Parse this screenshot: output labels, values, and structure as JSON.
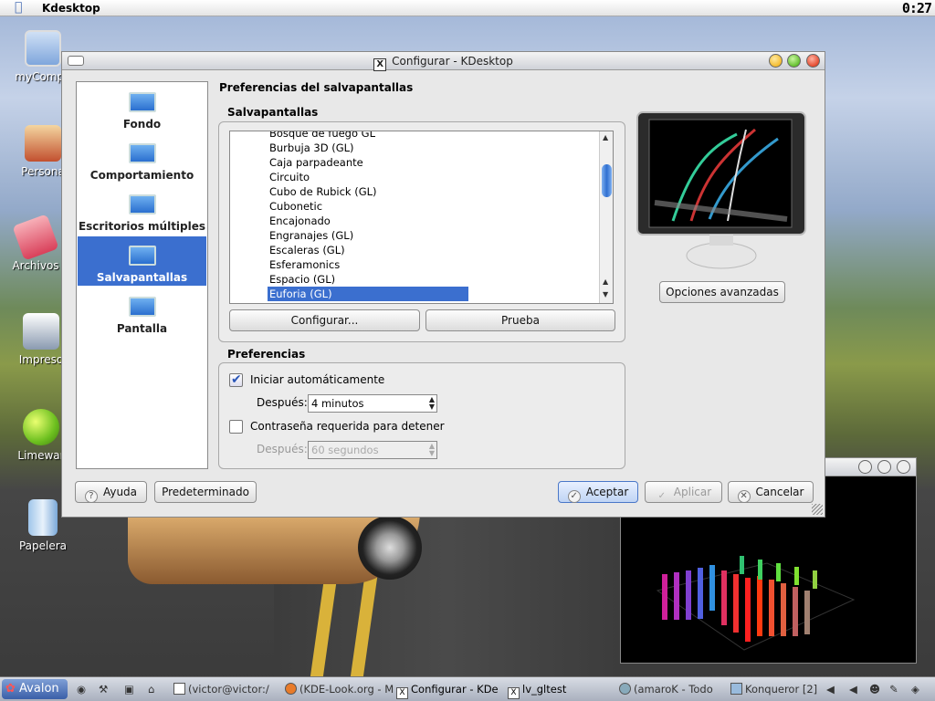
{
  "menubar": {
    "title": "Kdesktop",
    "clock": "0:27"
  },
  "desktop_icons": [
    {
      "label": "myCompu",
      "icon": "computer-icon"
    },
    {
      "label": "Persona",
      "icon": "home-icon"
    },
    {
      "label": "Archivos",
      "icon": "files-icon"
    },
    {
      "label": "Impreso",
      "icon": "printer-icon"
    },
    {
      "label": "Limewar",
      "icon": "limewire-icon"
    },
    {
      "label": "Papelera",
      "icon": "trash-icon"
    }
  ],
  "dialog": {
    "title": "Configurar - KDesktop",
    "sidebar": [
      {
        "label": "Fondo"
      },
      {
        "label": "Comportamiento"
      },
      {
        "label": "Escritorios múltiples"
      },
      {
        "label": "Salvapantallas",
        "selected": true
      },
      {
        "label": "Pantalla"
      }
    ],
    "heading": "Preferencias del salvapantallas",
    "saver_group": "Salvapantallas",
    "savers": [
      "Bosque de fuego GL",
      "Burbuja 3D (GL)",
      "Caja parpadeante",
      "Circuito",
      "Cubo de Rubick (GL)",
      "Cubonetic",
      "Encajonado",
      "Engranajes (GL)",
      "Escaleras (GL)",
      "Esferamonics",
      "Espacio (GL)",
      "Euforia (GL)"
    ],
    "selected_saver": "Euforia (GL)",
    "configure_btn": "Configurar...",
    "test_btn": "Prueba",
    "advanced_btn": "Opciones avanzadas",
    "prefs_group": "Preferencias",
    "auto_start": {
      "label": "Iniciar automáticamente",
      "checked": true
    },
    "after1_label": "Después:",
    "after1_value": "4 minutos",
    "password": {
      "label": "Contraseña requerida para detener",
      "checked": false
    },
    "after2_label": "Después:",
    "after2_value": "60 segundos",
    "buttons": {
      "help": "Ayuda",
      "defaults": "Predeterminado",
      "ok": "Aceptar",
      "apply": "Aplicar",
      "cancel": "Cancelar"
    }
  },
  "gl_window": {
    "title": ""
  },
  "taskbar": {
    "start": "Avalon",
    "tasks": [
      "(victor@victor:/",
      "(KDE-Look.org - M",
      "Configurar - KDe",
      "lv_gltest",
      "(amaroK - Todo",
      "Konqueror [2]"
    ]
  },
  "colors": {
    "selection": "#3b6fcf",
    "title_bar": "#d6d9df"
  }
}
